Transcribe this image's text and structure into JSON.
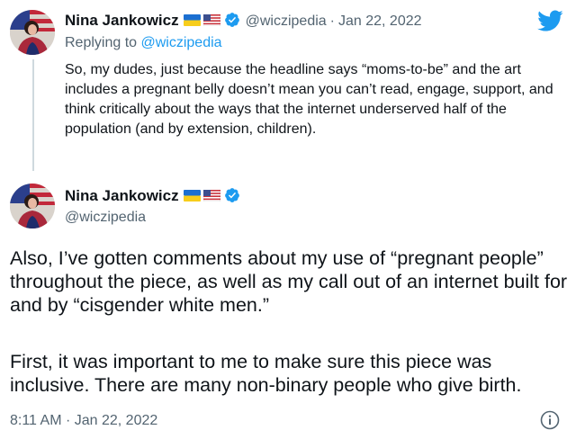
{
  "first_tweet": {
    "author_name": "Nina Jankowicz",
    "handle": "@wiczipedia",
    "separator": "·",
    "date": "Jan 22, 2022",
    "replying_label": "Replying to",
    "replying_handle": "@wiczipedia",
    "text": "So, my dudes, just because the headline says “moms-to-be” and the art includes a pregnant belly doesn’t mean you can’t read, engage, support, and think critically about the ways that the internet underserved half of the population (and by extension, children)."
  },
  "main_tweet": {
    "author_name": "Nina Jankowicz",
    "handle": "@wiczipedia",
    "paragraph_1": "Also, I’ve gotten comments about my use of “pregnant people” throughout the piece, as well as my call out of an internet built for and by “cisgender white men.”",
    "paragraph_2": "First, it was important to me to make sure this piece was inclusive. There are many non-binary people who give birth.",
    "timestamp": "8:11 AM · Jan 22, 2022"
  },
  "icons": {
    "logo": "twitter-bird-icon",
    "verified": "verified-badge-icon",
    "flags": [
      "ukraine-flag-icon",
      "us-flag-icon"
    ],
    "info": "info-icon"
  },
  "colors": {
    "twitter_blue": "#1d9bf0",
    "text": "#0f1419",
    "muted": "#536471",
    "thread_line": "#cfd9de"
  }
}
